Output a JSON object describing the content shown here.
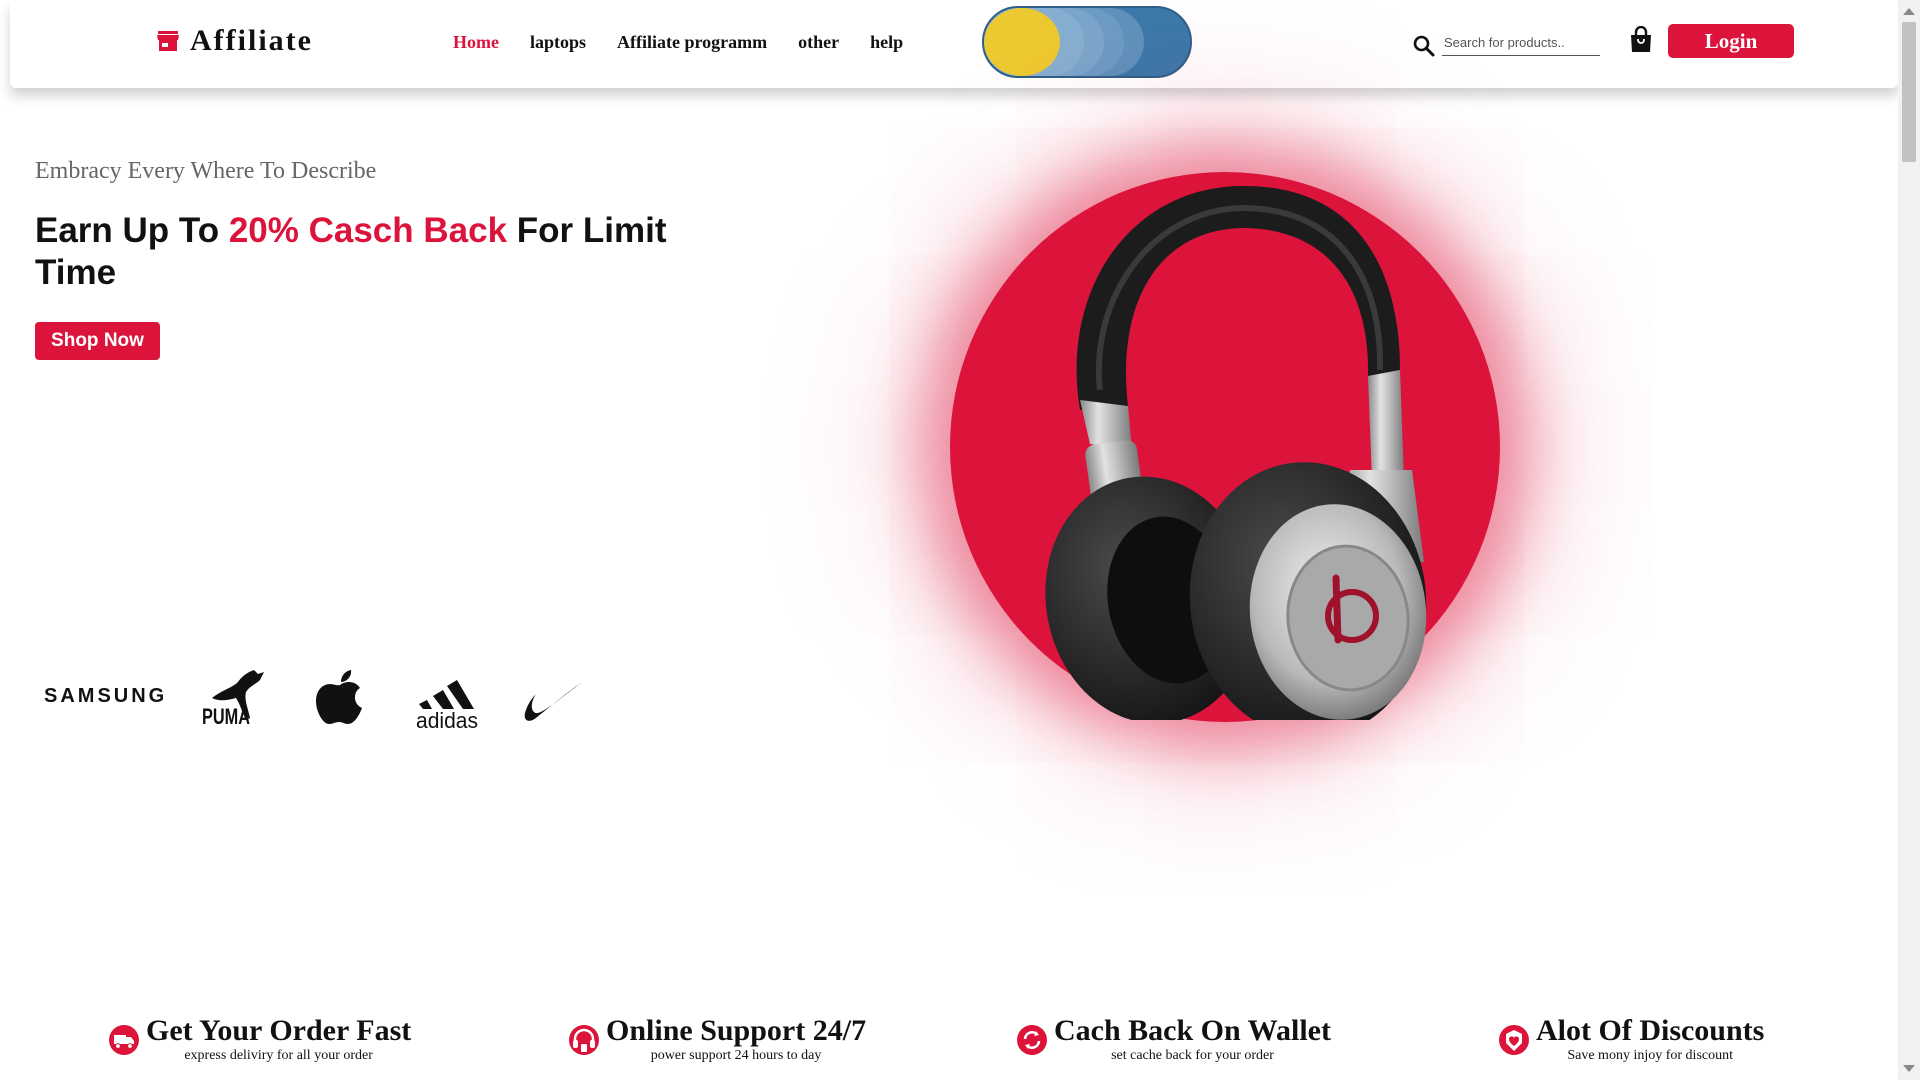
{
  "header": {
    "logo_text": "Affiliate",
    "nav": [
      {
        "label": "Home",
        "active": true
      },
      {
        "label": "laptops",
        "active": false
      },
      {
        "label": "Affiliate programm",
        "active": false
      },
      {
        "label": "other",
        "active": false
      },
      {
        "label": "help",
        "active": false
      }
    ],
    "search_placeholder": "Search for products..",
    "login_label": "Login"
  },
  "hero": {
    "subtitle": "Embracy Every Where To Describe",
    "title_pre": "Earn Up To ",
    "title_accent": "20% Casch Back",
    "title_post": " For Limit Time",
    "shop_label": "Shop Now",
    "brands": [
      "SAMSUNG",
      "PUMA",
      "apple",
      "adidas",
      "nike"
    ]
  },
  "features": [
    {
      "title": "Get Your Order Fast",
      "desc": "express deliviry for all your order",
      "icon": "truck-icon"
    },
    {
      "title": "Online Support 24/7",
      "desc": "power support 24 hours to day",
      "icon": "headset-icon"
    },
    {
      "title": "Cach Back On Wallet",
      "desc": "set cache back for your order",
      "icon": "refresh-icon"
    },
    {
      "title": "Alot Of Discounts",
      "desc": "Save mony injoy for discount",
      "icon": "heart-badge-icon"
    }
  ],
  "colors": {
    "accent": "#dc143c",
    "toggle_blue": "#3b79aa",
    "toggle_knob": "#ecc931"
  }
}
